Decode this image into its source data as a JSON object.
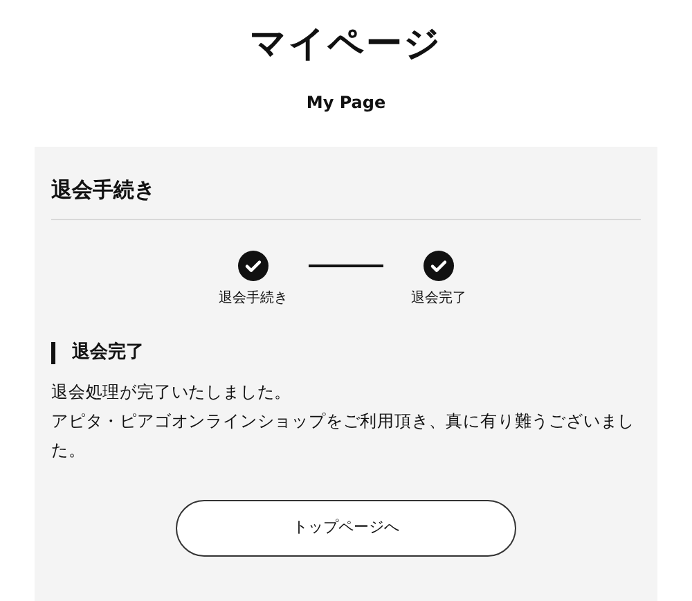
{
  "page_title": "マイページ",
  "page_subtitle": "My Page",
  "panel": {
    "heading": "退会手続き",
    "steps": [
      {
        "label": "退会手続き",
        "completed": true
      },
      {
        "label": "退会完了",
        "completed": true
      }
    ],
    "section_heading": "退会完了",
    "paragraphs": [
      "退会処理が完了いたしました。",
      "アピタ・ピアゴオンラインショップをご利用頂き、真に有り難うございました。"
    ],
    "button": "トップページへ"
  }
}
